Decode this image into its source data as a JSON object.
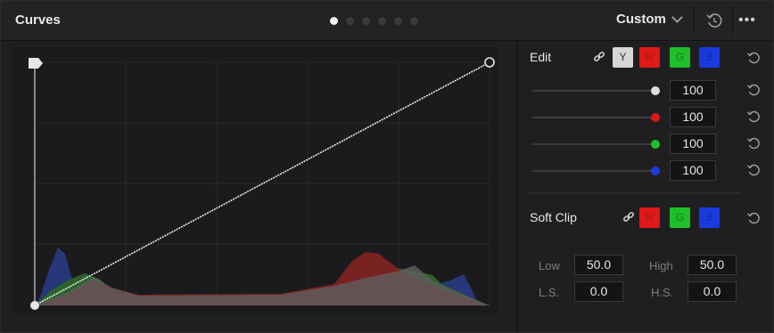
{
  "panel": {
    "title": "Curves",
    "mode": "Custom"
  },
  "edit": {
    "label": "Edit",
    "channels": [
      "Y",
      "R",
      "G",
      "B"
    ],
    "sliders": [
      {
        "channel": "Y",
        "value": "100",
        "color": "#e0e0e0"
      },
      {
        "channel": "R",
        "value": "100",
        "color": "#e01818"
      },
      {
        "channel": "G",
        "value": "100",
        "color": "#1fbf2a"
      },
      {
        "channel": "B",
        "value": "100",
        "color": "#1a3ae0"
      }
    ]
  },
  "soft_clip": {
    "label": "Soft Clip",
    "channels": [
      "R",
      "G",
      "B"
    ],
    "low_label": "Low",
    "low_value": "50.0",
    "high_label": "High",
    "high_value": "50.0",
    "ls_label": "L.S.",
    "ls_value": "0.0",
    "hs_label": "H.S.",
    "hs_value": "0.0"
  },
  "colors": {
    "red": "#e01818",
    "green": "#1fbf2a",
    "blue": "#1a3ae0",
    "luma": "#d6d6d6",
    "accent_dot": "#f2f2f2"
  }
}
